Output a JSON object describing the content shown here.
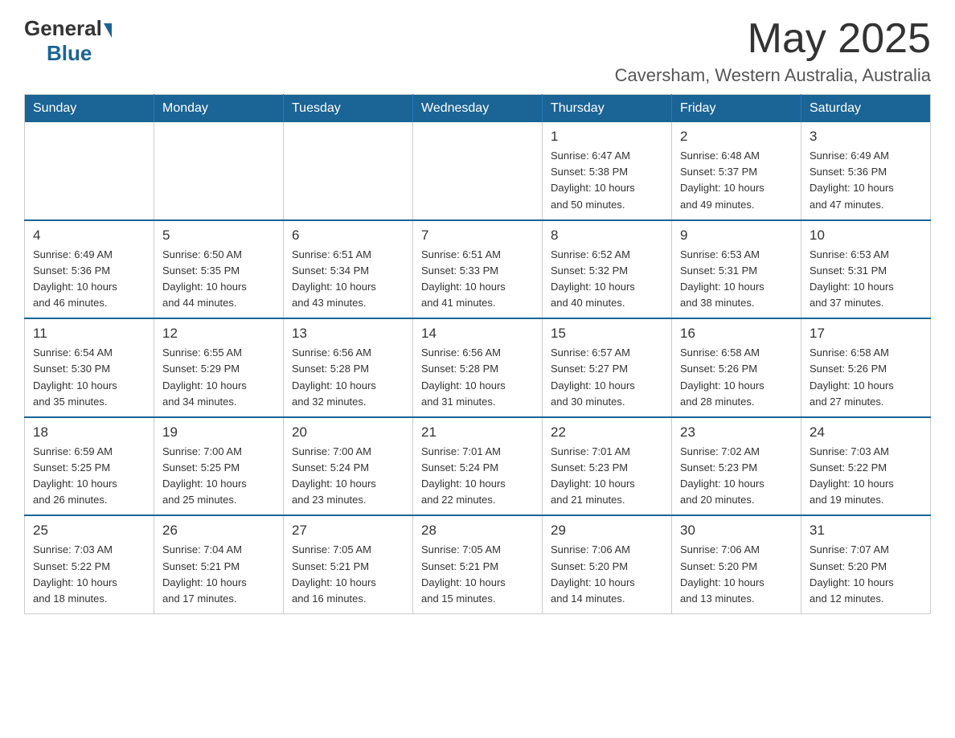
{
  "logo": {
    "general": "General",
    "blue": "Blue"
  },
  "title": "May 2025",
  "location": "Caversham, Western Australia, Australia",
  "days_of_week": [
    "Sunday",
    "Monday",
    "Tuesday",
    "Wednesday",
    "Thursday",
    "Friday",
    "Saturday"
  ],
  "weeks": [
    [
      {
        "day": "",
        "info": ""
      },
      {
        "day": "",
        "info": ""
      },
      {
        "day": "",
        "info": ""
      },
      {
        "day": "",
        "info": ""
      },
      {
        "day": "1",
        "info": "Sunrise: 6:47 AM\nSunset: 5:38 PM\nDaylight: 10 hours\nand 50 minutes."
      },
      {
        "day": "2",
        "info": "Sunrise: 6:48 AM\nSunset: 5:37 PM\nDaylight: 10 hours\nand 49 minutes."
      },
      {
        "day": "3",
        "info": "Sunrise: 6:49 AM\nSunset: 5:36 PM\nDaylight: 10 hours\nand 47 minutes."
      }
    ],
    [
      {
        "day": "4",
        "info": "Sunrise: 6:49 AM\nSunset: 5:36 PM\nDaylight: 10 hours\nand 46 minutes."
      },
      {
        "day": "5",
        "info": "Sunrise: 6:50 AM\nSunset: 5:35 PM\nDaylight: 10 hours\nand 44 minutes."
      },
      {
        "day": "6",
        "info": "Sunrise: 6:51 AM\nSunset: 5:34 PM\nDaylight: 10 hours\nand 43 minutes."
      },
      {
        "day": "7",
        "info": "Sunrise: 6:51 AM\nSunset: 5:33 PM\nDaylight: 10 hours\nand 41 minutes."
      },
      {
        "day": "8",
        "info": "Sunrise: 6:52 AM\nSunset: 5:32 PM\nDaylight: 10 hours\nand 40 minutes."
      },
      {
        "day": "9",
        "info": "Sunrise: 6:53 AM\nSunset: 5:31 PM\nDaylight: 10 hours\nand 38 minutes."
      },
      {
        "day": "10",
        "info": "Sunrise: 6:53 AM\nSunset: 5:31 PM\nDaylight: 10 hours\nand 37 minutes."
      }
    ],
    [
      {
        "day": "11",
        "info": "Sunrise: 6:54 AM\nSunset: 5:30 PM\nDaylight: 10 hours\nand 35 minutes."
      },
      {
        "day": "12",
        "info": "Sunrise: 6:55 AM\nSunset: 5:29 PM\nDaylight: 10 hours\nand 34 minutes."
      },
      {
        "day": "13",
        "info": "Sunrise: 6:56 AM\nSunset: 5:28 PM\nDaylight: 10 hours\nand 32 minutes."
      },
      {
        "day": "14",
        "info": "Sunrise: 6:56 AM\nSunset: 5:28 PM\nDaylight: 10 hours\nand 31 minutes."
      },
      {
        "day": "15",
        "info": "Sunrise: 6:57 AM\nSunset: 5:27 PM\nDaylight: 10 hours\nand 30 minutes."
      },
      {
        "day": "16",
        "info": "Sunrise: 6:58 AM\nSunset: 5:26 PM\nDaylight: 10 hours\nand 28 minutes."
      },
      {
        "day": "17",
        "info": "Sunrise: 6:58 AM\nSunset: 5:26 PM\nDaylight: 10 hours\nand 27 minutes."
      }
    ],
    [
      {
        "day": "18",
        "info": "Sunrise: 6:59 AM\nSunset: 5:25 PM\nDaylight: 10 hours\nand 26 minutes."
      },
      {
        "day": "19",
        "info": "Sunrise: 7:00 AM\nSunset: 5:25 PM\nDaylight: 10 hours\nand 25 minutes."
      },
      {
        "day": "20",
        "info": "Sunrise: 7:00 AM\nSunset: 5:24 PM\nDaylight: 10 hours\nand 23 minutes."
      },
      {
        "day": "21",
        "info": "Sunrise: 7:01 AM\nSunset: 5:24 PM\nDaylight: 10 hours\nand 22 minutes."
      },
      {
        "day": "22",
        "info": "Sunrise: 7:01 AM\nSunset: 5:23 PM\nDaylight: 10 hours\nand 21 minutes."
      },
      {
        "day": "23",
        "info": "Sunrise: 7:02 AM\nSunset: 5:23 PM\nDaylight: 10 hours\nand 20 minutes."
      },
      {
        "day": "24",
        "info": "Sunrise: 7:03 AM\nSunset: 5:22 PM\nDaylight: 10 hours\nand 19 minutes."
      }
    ],
    [
      {
        "day": "25",
        "info": "Sunrise: 7:03 AM\nSunset: 5:22 PM\nDaylight: 10 hours\nand 18 minutes."
      },
      {
        "day": "26",
        "info": "Sunrise: 7:04 AM\nSunset: 5:21 PM\nDaylight: 10 hours\nand 17 minutes."
      },
      {
        "day": "27",
        "info": "Sunrise: 7:05 AM\nSunset: 5:21 PM\nDaylight: 10 hours\nand 16 minutes."
      },
      {
        "day": "28",
        "info": "Sunrise: 7:05 AM\nSunset: 5:21 PM\nDaylight: 10 hours\nand 15 minutes."
      },
      {
        "day": "29",
        "info": "Sunrise: 7:06 AM\nSunset: 5:20 PM\nDaylight: 10 hours\nand 14 minutes."
      },
      {
        "day": "30",
        "info": "Sunrise: 7:06 AM\nSunset: 5:20 PM\nDaylight: 10 hours\nand 13 minutes."
      },
      {
        "day": "31",
        "info": "Sunrise: 7:07 AM\nSunset: 5:20 PM\nDaylight: 10 hours\nand 12 minutes."
      }
    ]
  ]
}
